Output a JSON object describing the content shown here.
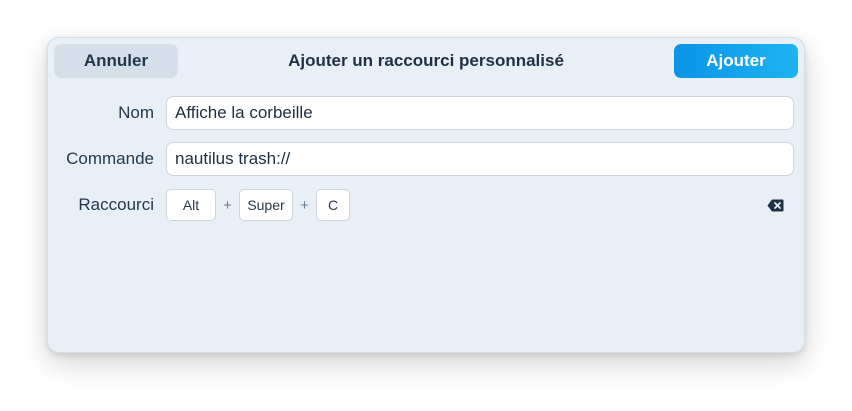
{
  "dialog": {
    "title": "Ajouter un raccourci personnalisé",
    "cancel_label": "Annuler",
    "add_label": "Ajouter"
  },
  "form": {
    "name_label": "Nom",
    "name_value": "Affiche la corbeille",
    "command_label": "Commande",
    "command_value": "nautilus trash://",
    "shortcut_label": "Raccourci",
    "shortcut_keys": [
      "Alt",
      "Super",
      "C"
    ],
    "key_separator": "+",
    "clear_icon": "backspace-icon"
  },
  "colors": {
    "accent": "#0a94e6",
    "dialog_bg": "#e9eff6"
  }
}
